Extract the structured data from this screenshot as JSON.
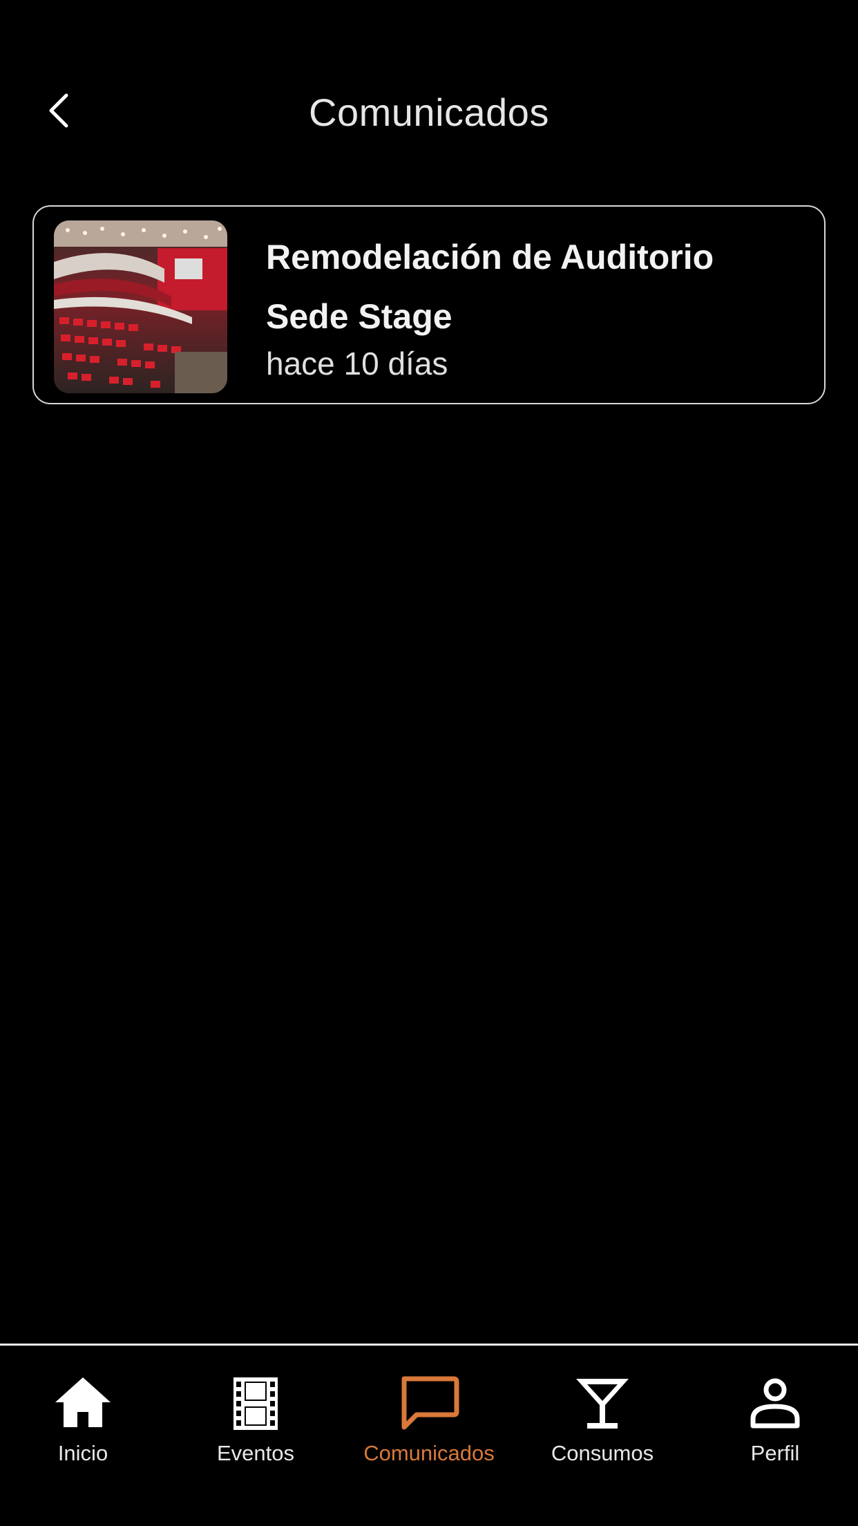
{
  "header": {
    "title": "Comunicados"
  },
  "announcements": [
    {
      "title": "Remodelación de Auditorio Sede Stage",
      "time": "hace 10 días",
      "image": "auditorium-photo"
    }
  ],
  "bottom_nav": {
    "active": "Comunicados",
    "accent_color": "#d9793a",
    "items": [
      {
        "label": "Inicio",
        "icon": "home-icon"
      },
      {
        "label": "Eventos",
        "icon": "film-icon"
      },
      {
        "label": "Comunicados",
        "icon": "chat-bubble-icon"
      },
      {
        "label": "Consumos",
        "icon": "cocktail-icon"
      },
      {
        "label": "Perfil",
        "icon": "user-icon"
      }
    ]
  }
}
